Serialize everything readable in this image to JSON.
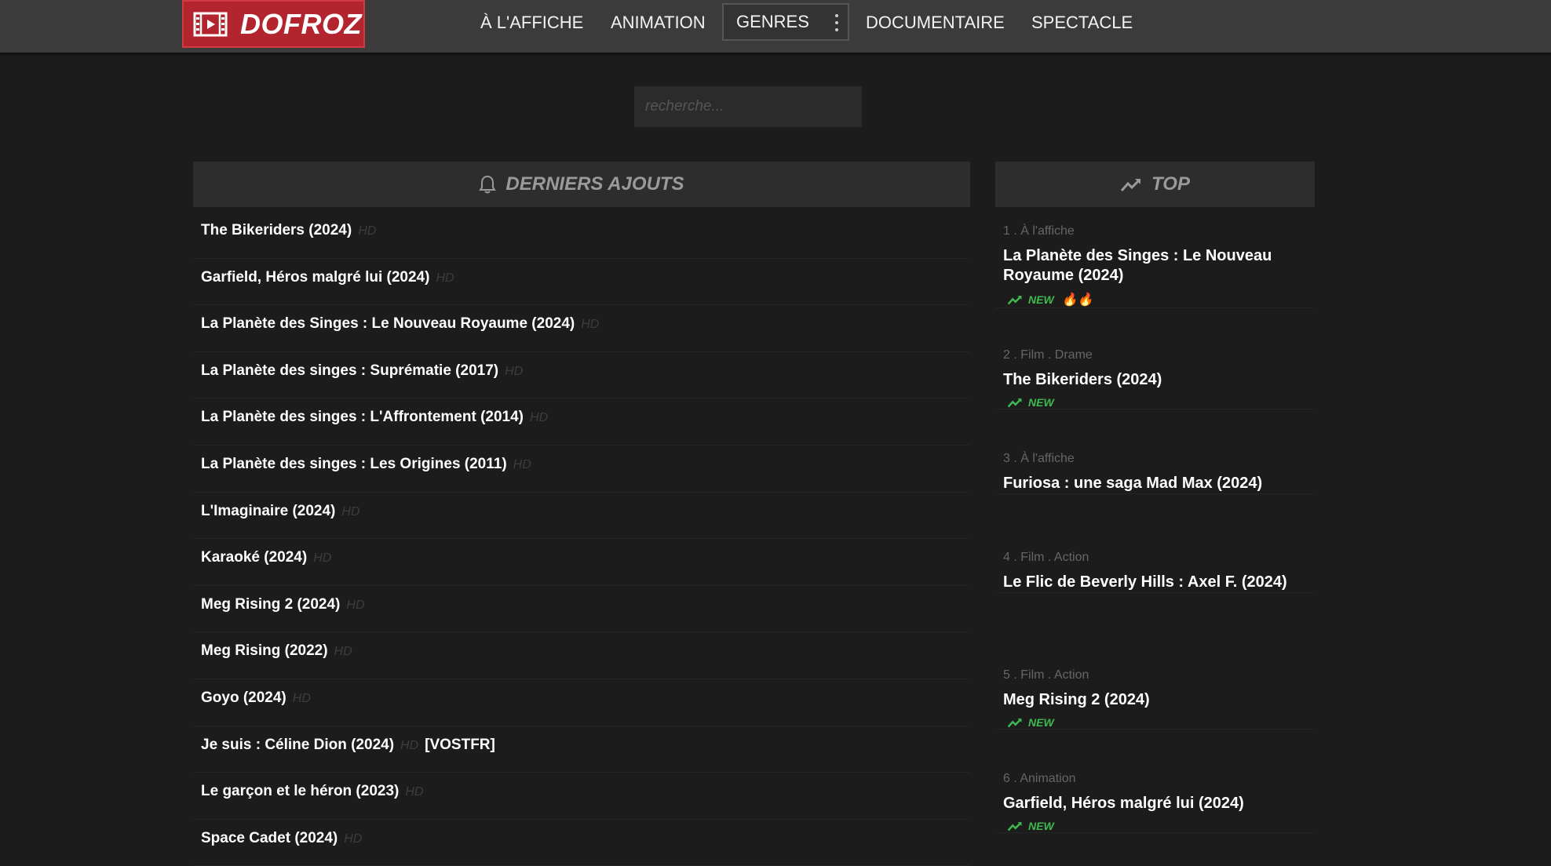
{
  "brand": {
    "name": "DOFROZ"
  },
  "nav": {
    "items": [
      "À L'AFFICHE",
      "ANIMATION",
      "GENRES",
      "DOCUMENTAIRE",
      "SPECTACLE"
    ]
  },
  "search": {
    "placeholder": "recherche..."
  },
  "latest": {
    "heading": "DERNIERS AJOUTS",
    "items": [
      {
        "title": "The Bikeriders (2024)",
        "quality": "HD",
        "extra": ""
      },
      {
        "title": "Garfield, Héros malgré lui (2024)",
        "quality": "HD",
        "extra": ""
      },
      {
        "title": "La Planète des Singes : Le Nouveau Royaume (2024)",
        "quality": "HD",
        "extra": ""
      },
      {
        "title": "La Planète des singes : Suprématie (2017)",
        "quality": "HD",
        "extra": ""
      },
      {
        "title": "La Planète des singes : L'Affrontement (2014)",
        "quality": "HD",
        "extra": ""
      },
      {
        "title": "La Planète des singes : Les Origines (2011)",
        "quality": "HD",
        "extra": ""
      },
      {
        "title": "L'Imaginaire (2024)",
        "quality": "HD",
        "extra": ""
      },
      {
        "title": "Karaoké (2024)",
        "quality": "HD",
        "extra": ""
      },
      {
        "title": "Meg Rising 2 (2024)",
        "quality": "HD",
        "extra": ""
      },
      {
        "title": "Meg Rising (2022)",
        "quality": "HD",
        "extra": ""
      },
      {
        "title": "Goyo (2024)",
        "quality": "HD",
        "extra": ""
      },
      {
        "title": "Je suis : Céline Dion (2024)",
        "quality": "HD",
        "extra": "[VOSTFR]"
      },
      {
        "title": "Le garçon et le héron (2023)",
        "quality": "HD",
        "extra": ""
      },
      {
        "title": "Space Cadet (2024)",
        "quality": "HD",
        "extra": ""
      }
    ]
  },
  "top": {
    "heading": "TOP",
    "items": [
      {
        "meta": "1 . À l'affiche",
        "title": "La Planète des Singes : Le Nouveau Royaume (2024)",
        "badge": "NEW",
        "flames": "🔥🔥"
      },
      {
        "meta": "2 . Film . Drame",
        "title": "The Bikeriders (2024)",
        "badge": "NEW",
        "flames": ""
      },
      {
        "meta": "3 . À l'affiche",
        "title": "Furiosa : une saga Mad Max (2024)",
        "badge": "",
        "flames": ""
      },
      {
        "meta": "4 . Film . Action",
        "title": "Le Flic de Beverly Hills : Axel F. (2024)",
        "badge": "",
        "flames": ""
      },
      {
        "meta": "5 . Film . Action",
        "title": "Meg Rising 2 (2024)",
        "badge": "NEW",
        "flames": ""
      },
      {
        "meta": "6 . Animation",
        "title": "Garfield, Héros malgré lui (2024)",
        "badge": "NEW",
        "flames": ""
      }
    ]
  },
  "colors": {
    "brand": "#b3252e",
    "topbar": "#3b3b3b",
    "background": "#1c1c1c",
    "new_badge": "#3fb950"
  },
  "icons": {
    "logo": "film-icon",
    "latest": "bell-icon",
    "top": "trending-icon",
    "badge": "trending-icon"
  }
}
